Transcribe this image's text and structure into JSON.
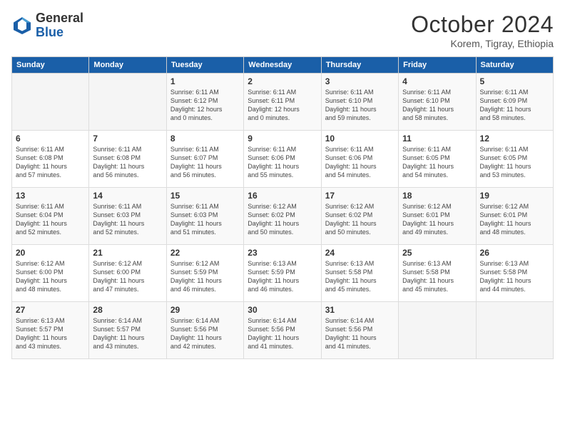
{
  "logo": {
    "general": "General",
    "blue": "Blue"
  },
  "header": {
    "month": "October 2024",
    "location": "Korem, Tigray, Ethiopia"
  },
  "weekdays": [
    "Sunday",
    "Monday",
    "Tuesday",
    "Wednesday",
    "Thursday",
    "Friday",
    "Saturday"
  ],
  "weeks": [
    [
      {
        "day": "",
        "info": ""
      },
      {
        "day": "",
        "info": ""
      },
      {
        "day": "1",
        "info": "Sunrise: 6:11 AM\nSunset: 6:12 PM\nDaylight: 12 hours\nand 0 minutes."
      },
      {
        "day": "2",
        "info": "Sunrise: 6:11 AM\nSunset: 6:11 PM\nDaylight: 12 hours\nand 0 minutes."
      },
      {
        "day": "3",
        "info": "Sunrise: 6:11 AM\nSunset: 6:10 PM\nDaylight: 11 hours\nand 59 minutes."
      },
      {
        "day": "4",
        "info": "Sunrise: 6:11 AM\nSunset: 6:10 PM\nDaylight: 11 hours\nand 58 minutes."
      },
      {
        "day": "5",
        "info": "Sunrise: 6:11 AM\nSunset: 6:09 PM\nDaylight: 11 hours\nand 58 minutes."
      }
    ],
    [
      {
        "day": "6",
        "info": "Sunrise: 6:11 AM\nSunset: 6:08 PM\nDaylight: 11 hours\nand 57 minutes."
      },
      {
        "day": "7",
        "info": "Sunrise: 6:11 AM\nSunset: 6:08 PM\nDaylight: 11 hours\nand 56 minutes."
      },
      {
        "day": "8",
        "info": "Sunrise: 6:11 AM\nSunset: 6:07 PM\nDaylight: 11 hours\nand 56 minutes."
      },
      {
        "day": "9",
        "info": "Sunrise: 6:11 AM\nSunset: 6:06 PM\nDaylight: 11 hours\nand 55 minutes."
      },
      {
        "day": "10",
        "info": "Sunrise: 6:11 AM\nSunset: 6:06 PM\nDaylight: 11 hours\nand 54 minutes."
      },
      {
        "day": "11",
        "info": "Sunrise: 6:11 AM\nSunset: 6:05 PM\nDaylight: 11 hours\nand 54 minutes."
      },
      {
        "day": "12",
        "info": "Sunrise: 6:11 AM\nSunset: 6:05 PM\nDaylight: 11 hours\nand 53 minutes."
      }
    ],
    [
      {
        "day": "13",
        "info": "Sunrise: 6:11 AM\nSunset: 6:04 PM\nDaylight: 11 hours\nand 52 minutes."
      },
      {
        "day": "14",
        "info": "Sunrise: 6:11 AM\nSunset: 6:03 PM\nDaylight: 11 hours\nand 52 minutes."
      },
      {
        "day": "15",
        "info": "Sunrise: 6:11 AM\nSunset: 6:03 PM\nDaylight: 11 hours\nand 51 minutes."
      },
      {
        "day": "16",
        "info": "Sunrise: 6:12 AM\nSunset: 6:02 PM\nDaylight: 11 hours\nand 50 minutes."
      },
      {
        "day": "17",
        "info": "Sunrise: 6:12 AM\nSunset: 6:02 PM\nDaylight: 11 hours\nand 50 minutes."
      },
      {
        "day": "18",
        "info": "Sunrise: 6:12 AM\nSunset: 6:01 PM\nDaylight: 11 hours\nand 49 minutes."
      },
      {
        "day": "19",
        "info": "Sunrise: 6:12 AM\nSunset: 6:01 PM\nDaylight: 11 hours\nand 48 minutes."
      }
    ],
    [
      {
        "day": "20",
        "info": "Sunrise: 6:12 AM\nSunset: 6:00 PM\nDaylight: 11 hours\nand 48 minutes."
      },
      {
        "day": "21",
        "info": "Sunrise: 6:12 AM\nSunset: 6:00 PM\nDaylight: 11 hours\nand 47 minutes."
      },
      {
        "day": "22",
        "info": "Sunrise: 6:12 AM\nSunset: 5:59 PM\nDaylight: 11 hours\nand 46 minutes."
      },
      {
        "day": "23",
        "info": "Sunrise: 6:13 AM\nSunset: 5:59 PM\nDaylight: 11 hours\nand 46 minutes."
      },
      {
        "day": "24",
        "info": "Sunrise: 6:13 AM\nSunset: 5:58 PM\nDaylight: 11 hours\nand 45 minutes."
      },
      {
        "day": "25",
        "info": "Sunrise: 6:13 AM\nSunset: 5:58 PM\nDaylight: 11 hours\nand 45 minutes."
      },
      {
        "day": "26",
        "info": "Sunrise: 6:13 AM\nSunset: 5:58 PM\nDaylight: 11 hours\nand 44 minutes."
      }
    ],
    [
      {
        "day": "27",
        "info": "Sunrise: 6:13 AM\nSunset: 5:57 PM\nDaylight: 11 hours\nand 43 minutes."
      },
      {
        "day": "28",
        "info": "Sunrise: 6:14 AM\nSunset: 5:57 PM\nDaylight: 11 hours\nand 43 minutes."
      },
      {
        "day": "29",
        "info": "Sunrise: 6:14 AM\nSunset: 5:56 PM\nDaylight: 11 hours\nand 42 minutes."
      },
      {
        "day": "30",
        "info": "Sunrise: 6:14 AM\nSunset: 5:56 PM\nDaylight: 11 hours\nand 41 minutes."
      },
      {
        "day": "31",
        "info": "Sunrise: 6:14 AM\nSunset: 5:56 PM\nDaylight: 11 hours\nand 41 minutes."
      },
      {
        "day": "",
        "info": ""
      },
      {
        "day": "",
        "info": ""
      }
    ]
  ]
}
